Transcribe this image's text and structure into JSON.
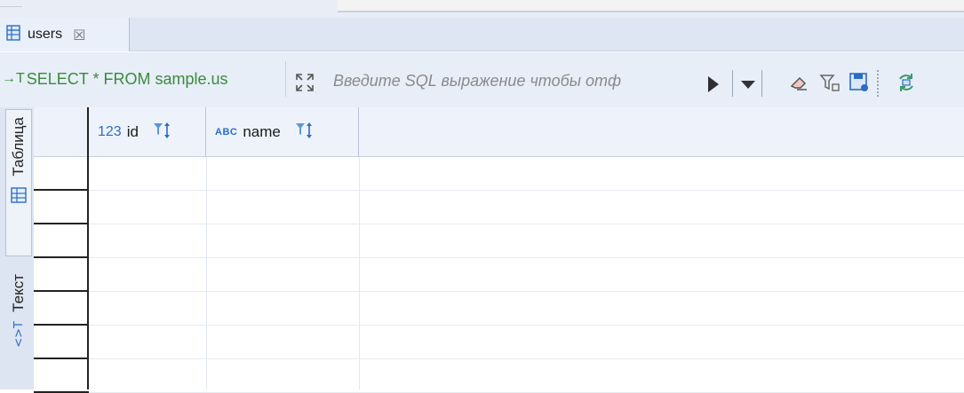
{
  "editor": {
    "tab": {
      "label": "users",
      "close_icon": "close-icon"
    }
  },
  "toolbar": {
    "query_prefix": "→T",
    "query_text": "SELECT * FROM sample.us",
    "filter_placeholder": "Введите SQL выражение чтобы отф",
    "icons": [
      "expand-icon",
      "apply-filter-icon",
      "dropdown-icon",
      "eraser-icon",
      "filter-icon",
      "save-filter-icon",
      "refresh-icon"
    ]
  },
  "sidebar": {
    "tabs": [
      {
        "label": "Таблица",
        "icon": "grid-icon",
        "active": true
      },
      {
        "label": "Текст",
        "icon": "text-icon",
        "active": false
      }
    ]
  },
  "grid": {
    "columns": [
      {
        "type_badge": "123",
        "label": "id"
      },
      {
        "type_badge": "ABC",
        "label": "name"
      }
    ],
    "rows": []
  },
  "colors": {
    "query_text": "#3b8b3b",
    "type_badge": "#2b6cc4",
    "toolbar_bg": "#e7eef8"
  }
}
